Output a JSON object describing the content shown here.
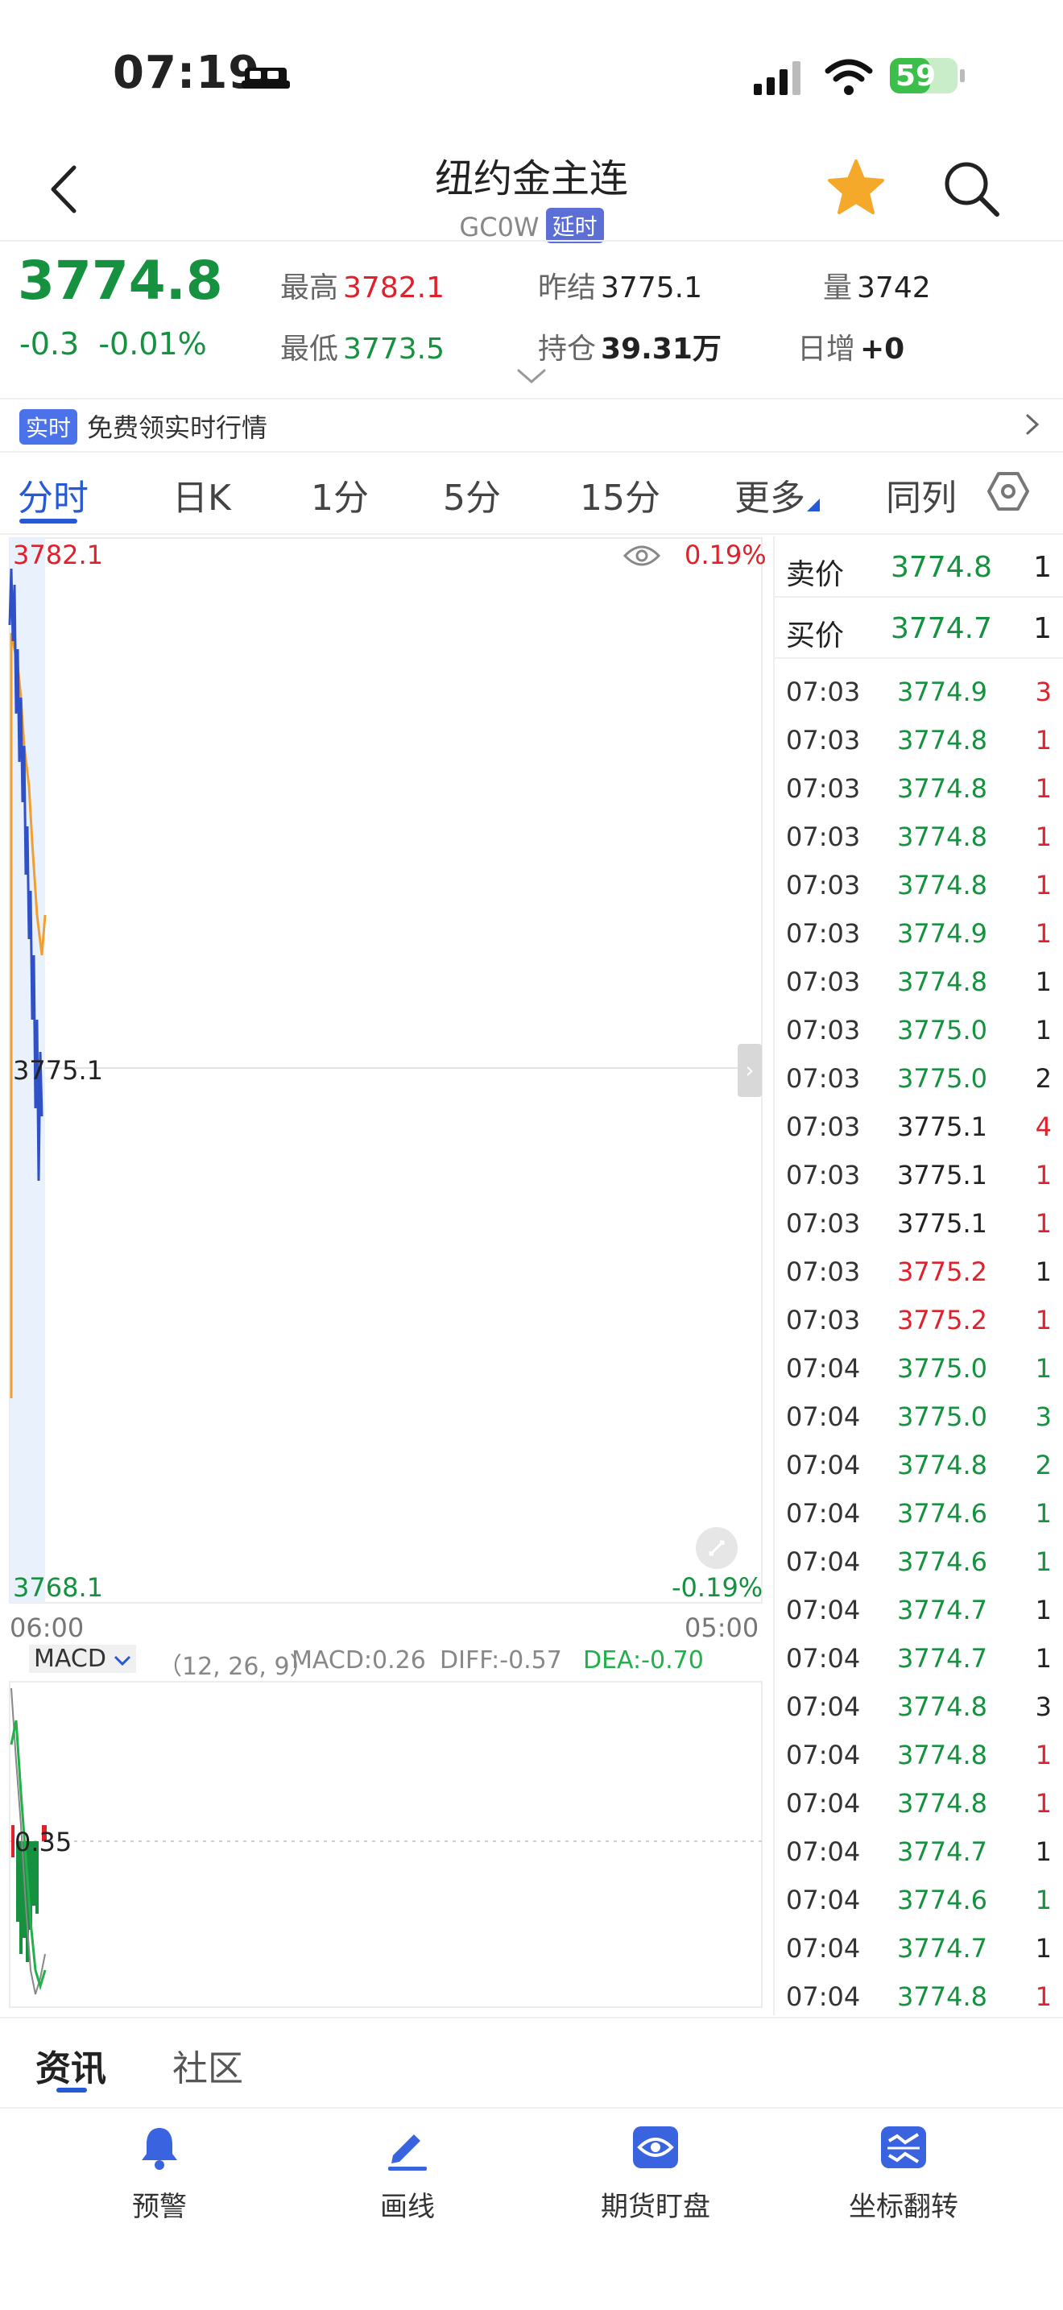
{
  "status_bar": {
    "time": "07:19",
    "battery": "59"
  },
  "header": {
    "title": "纽约金主连",
    "code": "GC0W",
    "delay_badge": "延时"
  },
  "quote": {
    "last": "3774.8",
    "change": "-0.3",
    "change_pct": "-0.01%",
    "high_label": "最高",
    "high": "3782.1",
    "low_label": "最低",
    "low": "3773.5",
    "prev_settle_label": "昨结",
    "prev_settle": "3775.1",
    "open_interest_label": "持仓",
    "open_interest": "39.31万",
    "volume_label": "量",
    "volume": "3742",
    "daily_inc_label": "日增",
    "daily_inc": "+0"
  },
  "realtime_banner": {
    "badge": "实时",
    "text": "免费领实时行情"
  },
  "tabs": [
    "分时",
    "日K",
    "1分",
    "5分",
    "15分",
    "更多",
    "同列"
  ],
  "chart": {
    "top_price": "3782.1",
    "top_pct": "0.19%",
    "mid_price": "3775.1",
    "bottom_price": "3768.1",
    "bottom_pct": "-0.19%",
    "start_time": "06:00",
    "end_time": "05:00",
    "macd_indicator": "MACD",
    "macd_params": "（12, 26, 9）",
    "macd_value": "MACD:0.26",
    "diff_value": "DIFF:-0.57",
    "dea_value": "DEA:-0.70",
    "macd_axis": "0.35"
  },
  "orderbook": {
    "ask_label": "卖价",
    "ask_price": "3774.8",
    "ask_qty": "1",
    "bid_label": "买价",
    "bid_price": "3774.7",
    "bid_qty": "1"
  },
  "trades": [
    {
      "time": "07:03",
      "price": "3774.9",
      "qty": "3",
      "pc": "green",
      "qc": "red"
    },
    {
      "time": "07:03",
      "price": "3774.8",
      "qty": "1",
      "pc": "green",
      "qc": "red"
    },
    {
      "time": "07:03",
      "price": "3774.8",
      "qty": "1",
      "pc": "green",
      "qc": "red"
    },
    {
      "time": "07:03",
      "price": "3774.8",
      "qty": "1",
      "pc": "green",
      "qc": "red"
    },
    {
      "time": "07:03",
      "price": "3774.8",
      "qty": "1",
      "pc": "green",
      "qc": "red"
    },
    {
      "time": "07:03",
      "price": "3774.9",
      "qty": "1",
      "pc": "green",
      "qc": "red"
    },
    {
      "time": "07:03",
      "price": "3774.8",
      "qty": "1",
      "pc": "green",
      "qc": "dark"
    },
    {
      "time": "07:03",
      "price": "3775.0",
      "qty": "1",
      "pc": "green",
      "qc": "dark"
    },
    {
      "time": "07:03",
      "price": "3775.0",
      "qty": "2",
      "pc": "green",
      "qc": "dark"
    },
    {
      "time": "07:03",
      "price": "3775.1",
      "qty": "4",
      "pc": "dark",
      "qc": "red"
    },
    {
      "time": "07:03",
      "price": "3775.1",
      "qty": "1",
      "pc": "dark",
      "qc": "red"
    },
    {
      "time": "07:03",
      "price": "3775.1",
      "qty": "1",
      "pc": "dark",
      "qc": "red"
    },
    {
      "time": "07:03",
      "price": "3775.2",
      "qty": "1",
      "pc": "red",
      "qc": "dark"
    },
    {
      "time": "07:03",
      "price": "3775.2",
      "qty": "1",
      "pc": "red",
      "qc": "red"
    },
    {
      "time": "07:04",
      "price": "3775.0",
      "qty": "1",
      "pc": "green",
      "qc": "green"
    },
    {
      "time": "07:04",
      "price": "3775.0",
      "qty": "3",
      "pc": "green",
      "qc": "green"
    },
    {
      "time": "07:04",
      "price": "3774.8",
      "qty": "2",
      "pc": "green",
      "qc": "green"
    },
    {
      "time": "07:04",
      "price": "3774.6",
      "qty": "1",
      "pc": "green",
      "qc": "green"
    },
    {
      "time": "07:04",
      "price": "3774.6",
      "qty": "1",
      "pc": "green",
      "qc": "green"
    },
    {
      "time": "07:04",
      "price": "3774.7",
      "qty": "1",
      "pc": "green",
      "qc": "dark"
    },
    {
      "time": "07:04",
      "price": "3774.7",
      "qty": "1",
      "pc": "green",
      "qc": "dark"
    },
    {
      "time": "07:04",
      "price": "3774.8",
      "qty": "3",
      "pc": "green",
      "qc": "dark"
    },
    {
      "time": "07:04",
      "price": "3774.8",
      "qty": "1",
      "pc": "green",
      "qc": "red"
    },
    {
      "time": "07:04",
      "price": "3774.8",
      "qty": "1",
      "pc": "green",
      "qc": "red"
    },
    {
      "time": "07:04",
      "price": "3774.7",
      "qty": "1",
      "pc": "green",
      "qc": "dark"
    },
    {
      "time": "07:04",
      "price": "3774.6",
      "qty": "1",
      "pc": "green",
      "qc": "green"
    },
    {
      "time": "07:04",
      "price": "3774.7",
      "qty": "1",
      "pc": "green",
      "qc": "dark"
    },
    {
      "time": "07:04",
      "price": "3774.8",
      "qty": "1",
      "pc": "green",
      "qc": "red"
    }
  ],
  "news_tabs": [
    "资讯",
    "社区"
  ],
  "bottom_actions": [
    {
      "label": "预警",
      "icon": "bell-icon"
    },
    {
      "label": "画线",
      "icon": "draw-pen-icon"
    },
    {
      "label": "期货盯盘",
      "icon": "eye-watch-icon"
    },
    {
      "label": "坐标翻转",
      "icon": "axis-flip-icon"
    }
  ],
  "colors": {
    "up": "#e0212b",
    "down": "#15913f",
    "accent": "#2659d6",
    "price_line": "#3050c8",
    "avg_line": "#f0a030"
  }
}
